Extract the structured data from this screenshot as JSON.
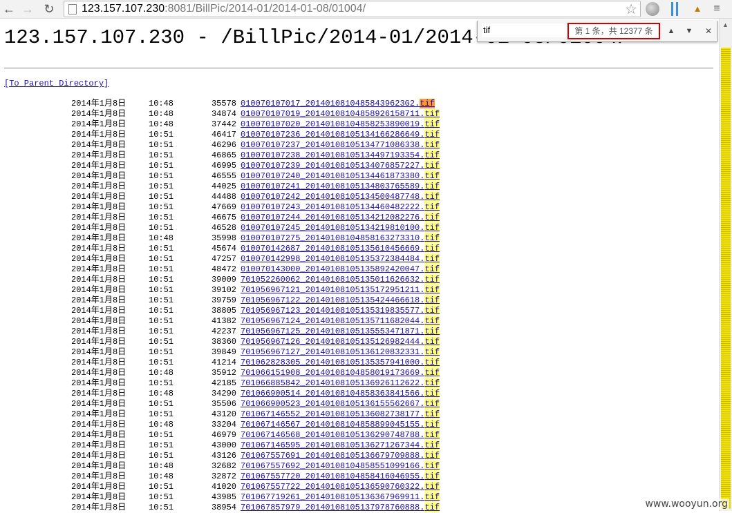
{
  "browser": {
    "url_host": "123.157.107.230",
    "url_rest": ":8081/BillPic/2014-01/2014-01-08/01004/"
  },
  "find": {
    "query": "tif",
    "count": "第 1 条，共 12377 条"
  },
  "page": {
    "title": "123.157.107.230 - /BillPic/2014-01/2014-01-08/01004/",
    "parent_link": "[To Parent Directory]"
  },
  "colors": {
    "match_active": "#ff9632",
    "match": "#ffff7a",
    "find_count_border": "#d40000"
  },
  "files": [
    {
      "date": "2014年1月8日",
      "time": "10:48",
      "size": "35578",
      "name": "010070107017_20140108104858439623G2.",
      "ext": "tif"
    },
    {
      "date": "2014年1月8日",
      "time": "10:48",
      "size": "34874",
      "name": "010070107019_20140108104858926158711.",
      "ext": "tif"
    },
    {
      "date": "2014年1月8日",
      "time": "10:48",
      "size": "37442",
      "name": "010070107020_20140108104858253890019.",
      "ext": "tif"
    },
    {
      "date": "2014年1月8日",
      "time": "10:51",
      "size": "46417",
      "name": "010070107236_20140108105134166286649.",
      "ext": "tif"
    },
    {
      "date": "2014年1月8日",
      "time": "10:51",
      "size": "46296",
      "name": "010070107237_20140108105134771086338.",
      "ext": "tif"
    },
    {
      "date": "2014年1月8日",
      "time": "10:51",
      "size": "46865",
      "name": "010070107238_20140108105134497193354.",
      "ext": "tif"
    },
    {
      "date": "2014年1月8日",
      "time": "10:51",
      "size": "46995",
      "name": "010070107239_20140108105134076857227.",
      "ext": "tif"
    },
    {
      "date": "2014年1月8日",
      "time": "10:51",
      "size": "46555",
      "name": "010070107240_20140108105134461873380.",
      "ext": "tif"
    },
    {
      "date": "2014年1月8日",
      "time": "10:51",
      "size": "44025",
      "name": "010070107241_20140108105134803765589.",
      "ext": "tif"
    },
    {
      "date": "2014年1月8日",
      "time": "10:51",
      "size": "44488",
      "name": "010070107242_20140108105134500487748.",
      "ext": "tif"
    },
    {
      "date": "2014年1月8日",
      "time": "10:51",
      "size": "47669",
      "name": "010070107243_20140108105134460482222.",
      "ext": "tif"
    },
    {
      "date": "2014年1月8日",
      "time": "10:51",
      "size": "46675",
      "name": "010070107244_20140108105134212082276.",
      "ext": "tif"
    },
    {
      "date": "2014年1月8日",
      "time": "10:51",
      "size": "46528",
      "name": "010070107245_20140108105134219810100.",
      "ext": "tif"
    },
    {
      "date": "2014年1月8日",
      "time": "10:48",
      "size": "35998",
      "name": "010070107275_20140108104858163273310.",
      "ext": "tif"
    },
    {
      "date": "2014年1月8日",
      "time": "10:51",
      "size": "45674",
      "name": "010070142687_20140108105135610456669.",
      "ext": "tif"
    },
    {
      "date": "2014年1月8日",
      "time": "10:51",
      "size": "47257",
      "name": "010070142998_20140108105135372384484.",
      "ext": "tif"
    },
    {
      "date": "2014年1月8日",
      "time": "10:51",
      "size": "48472",
      "name": "010070143000_20140108105135892420047.",
      "ext": "tif"
    },
    {
      "date": "2014年1月8日",
      "time": "10:51",
      "size": "39009",
      "name": "701052260062_20140108105135011626632.",
      "ext": "tif"
    },
    {
      "date": "2014年1月8日",
      "time": "10:51",
      "size": "39102",
      "name": "701056967121_20140108105135172951211.",
      "ext": "tif"
    },
    {
      "date": "2014年1月8日",
      "time": "10:51",
      "size": "39759",
      "name": "701056967122_20140108105135424466618.",
      "ext": "tif"
    },
    {
      "date": "2014年1月8日",
      "time": "10:51",
      "size": "38805",
      "name": "701056967123_20140108105135319835577.",
      "ext": "tif"
    },
    {
      "date": "2014年1月8日",
      "time": "10:51",
      "size": "41382",
      "name": "701056967124_20140108105135711682044.",
      "ext": "tif"
    },
    {
      "date": "2014年1月8日",
      "time": "10:51",
      "size": "42237",
      "name": "701056967125_20140108105135553471871.",
      "ext": "tif"
    },
    {
      "date": "2014年1月8日",
      "time": "10:51",
      "size": "38360",
      "name": "701056967126_20140108105135126982444.",
      "ext": "tif"
    },
    {
      "date": "2014年1月8日",
      "time": "10:51",
      "size": "39849",
      "name": "701056967127_20140108105136120832331.",
      "ext": "tif"
    },
    {
      "date": "2014年1月8日",
      "time": "10:51",
      "size": "41214",
      "name": "701062828305_20140108105135357941000.",
      "ext": "tif"
    },
    {
      "date": "2014年1月8日",
      "time": "10:48",
      "size": "35912",
      "name": "701066151908_20140108104858019173669.",
      "ext": "tif"
    },
    {
      "date": "2014年1月8日",
      "time": "10:51",
      "size": "42185",
      "name": "701066885842_20140108105136926112622.",
      "ext": "tif"
    },
    {
      "date": "2014年1月8日",
      "time": "10:48",
      "size": "34290",
      "name": "701066900514_20140108104858363841566.",
      "ext": "tif"
    },
    {
      "date": "2014年1月8日",
      "time": "10:51",
      "size": "35506",
      "name": "701066900523_20140108105136155562667.",
      "ext": "tif"
    },
    {
      "date": "2014年1月8日",
      "time": "10:51",
      "size": "43120",
      "name": "701067146552_20140108105136082738177.",
      "ext": "tif"
    },
    {
      "date": "2014年1月8日",
      "time": "10:48",
      "size": "33204",
      "name": "701067146567_20140108104858899045155.",
      "ext": "tif"
    },
    {
      "date": "2014年1月8日",
      "time": "10:51",
      "size": "46979",
      "name": "701067146568_20140108105136290748788.",
      "ext": "tif"
    },
    {
      "date": "2014年1月8日",
      "time": "10:51",
      "size": "43000",
      "name": "701067146595_20140108105136271267344.",
      "ext": "tif"
    },
    {
      "date": "2014年1月8日",
      "time": "10:51",
      "size": "43126",
      "name": "701067557691_20140108105136679709888.",
      "ext": "tif"
    },
    {
      "date": "2014年1月8日",
      "time": "10:48",
      "size": "32682",
      "name": "701067557692_20140108104858551099166.",
      "ext": "tif"
    },
    {
      "date": "2014年1月8日",
      "time": "10:48",
      "size": "32872",
      "name": "701067557720_20140108104858416046955.",
      "ext": "tif"
    },
    {
      "date": "2014年1月8日",
      "time": "10:51",
      "size": "41020",
      "name": "701067557722_20140108105136590760322.",
      "ext": "tif"
    },
    {
      "date": "2014年1月8日",
      "time": "10:51",
      "size": "43985",
      "name": "701067719261_20140108105136367969911.",
      "ext": "tif"
    },
    {
      "date": "2014年1月8日",
      "time": "10:51",
      "size": "38954",
      "name": "701067857979_20140108105137978760888.",
      "ext": "tif"
    }
  ],
  "watermark": "www.wooyun.org"
}
